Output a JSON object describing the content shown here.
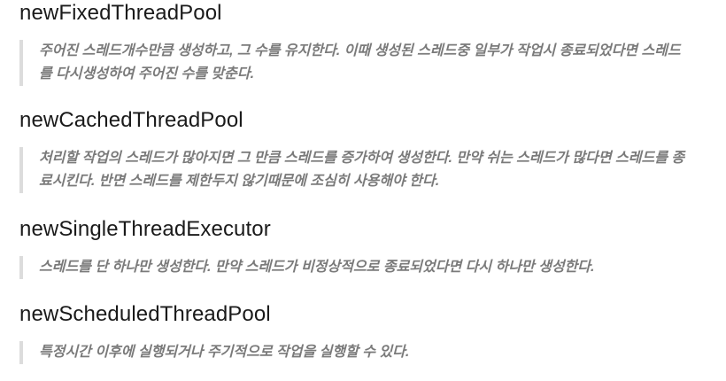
{
  "sections": [
    {
      "title": "newFixedThreadPool",
      "description": "주어진 스레드개수만큼 생성하고, 그 수를 유지한다. 이때 생성된 스레드중 일부가 작업시 종료되었다면 스레드를 다시생성하여 주어진 수를 맞춘다."
    },
    {
      "title": "newCachedThreadPool",
      "description": "처리할 작업의 스레드가 많아지면 그 만큼 스레드를 증가하여 생성한다. 만약 쉬는 스레드가 많다면 스레드를 종료시킨다. 반면 스레드를 제한두지 않기때문에 조심히 사용해야 한다."
    },
    {
      "title": "newSingleThreadExecutor",
      "description": "스레드를 단 하나만 생성한다. 만약 스레드가 비정상적으로 종료되었다면 다시 하나만 생성한다."
    },
    {
      "title": "newScheduledThreadPool",
      "description": "특정시간 이후에 실행되거나 주기적으로 작업을 실행할 수 있다."
    }
  ]
}
